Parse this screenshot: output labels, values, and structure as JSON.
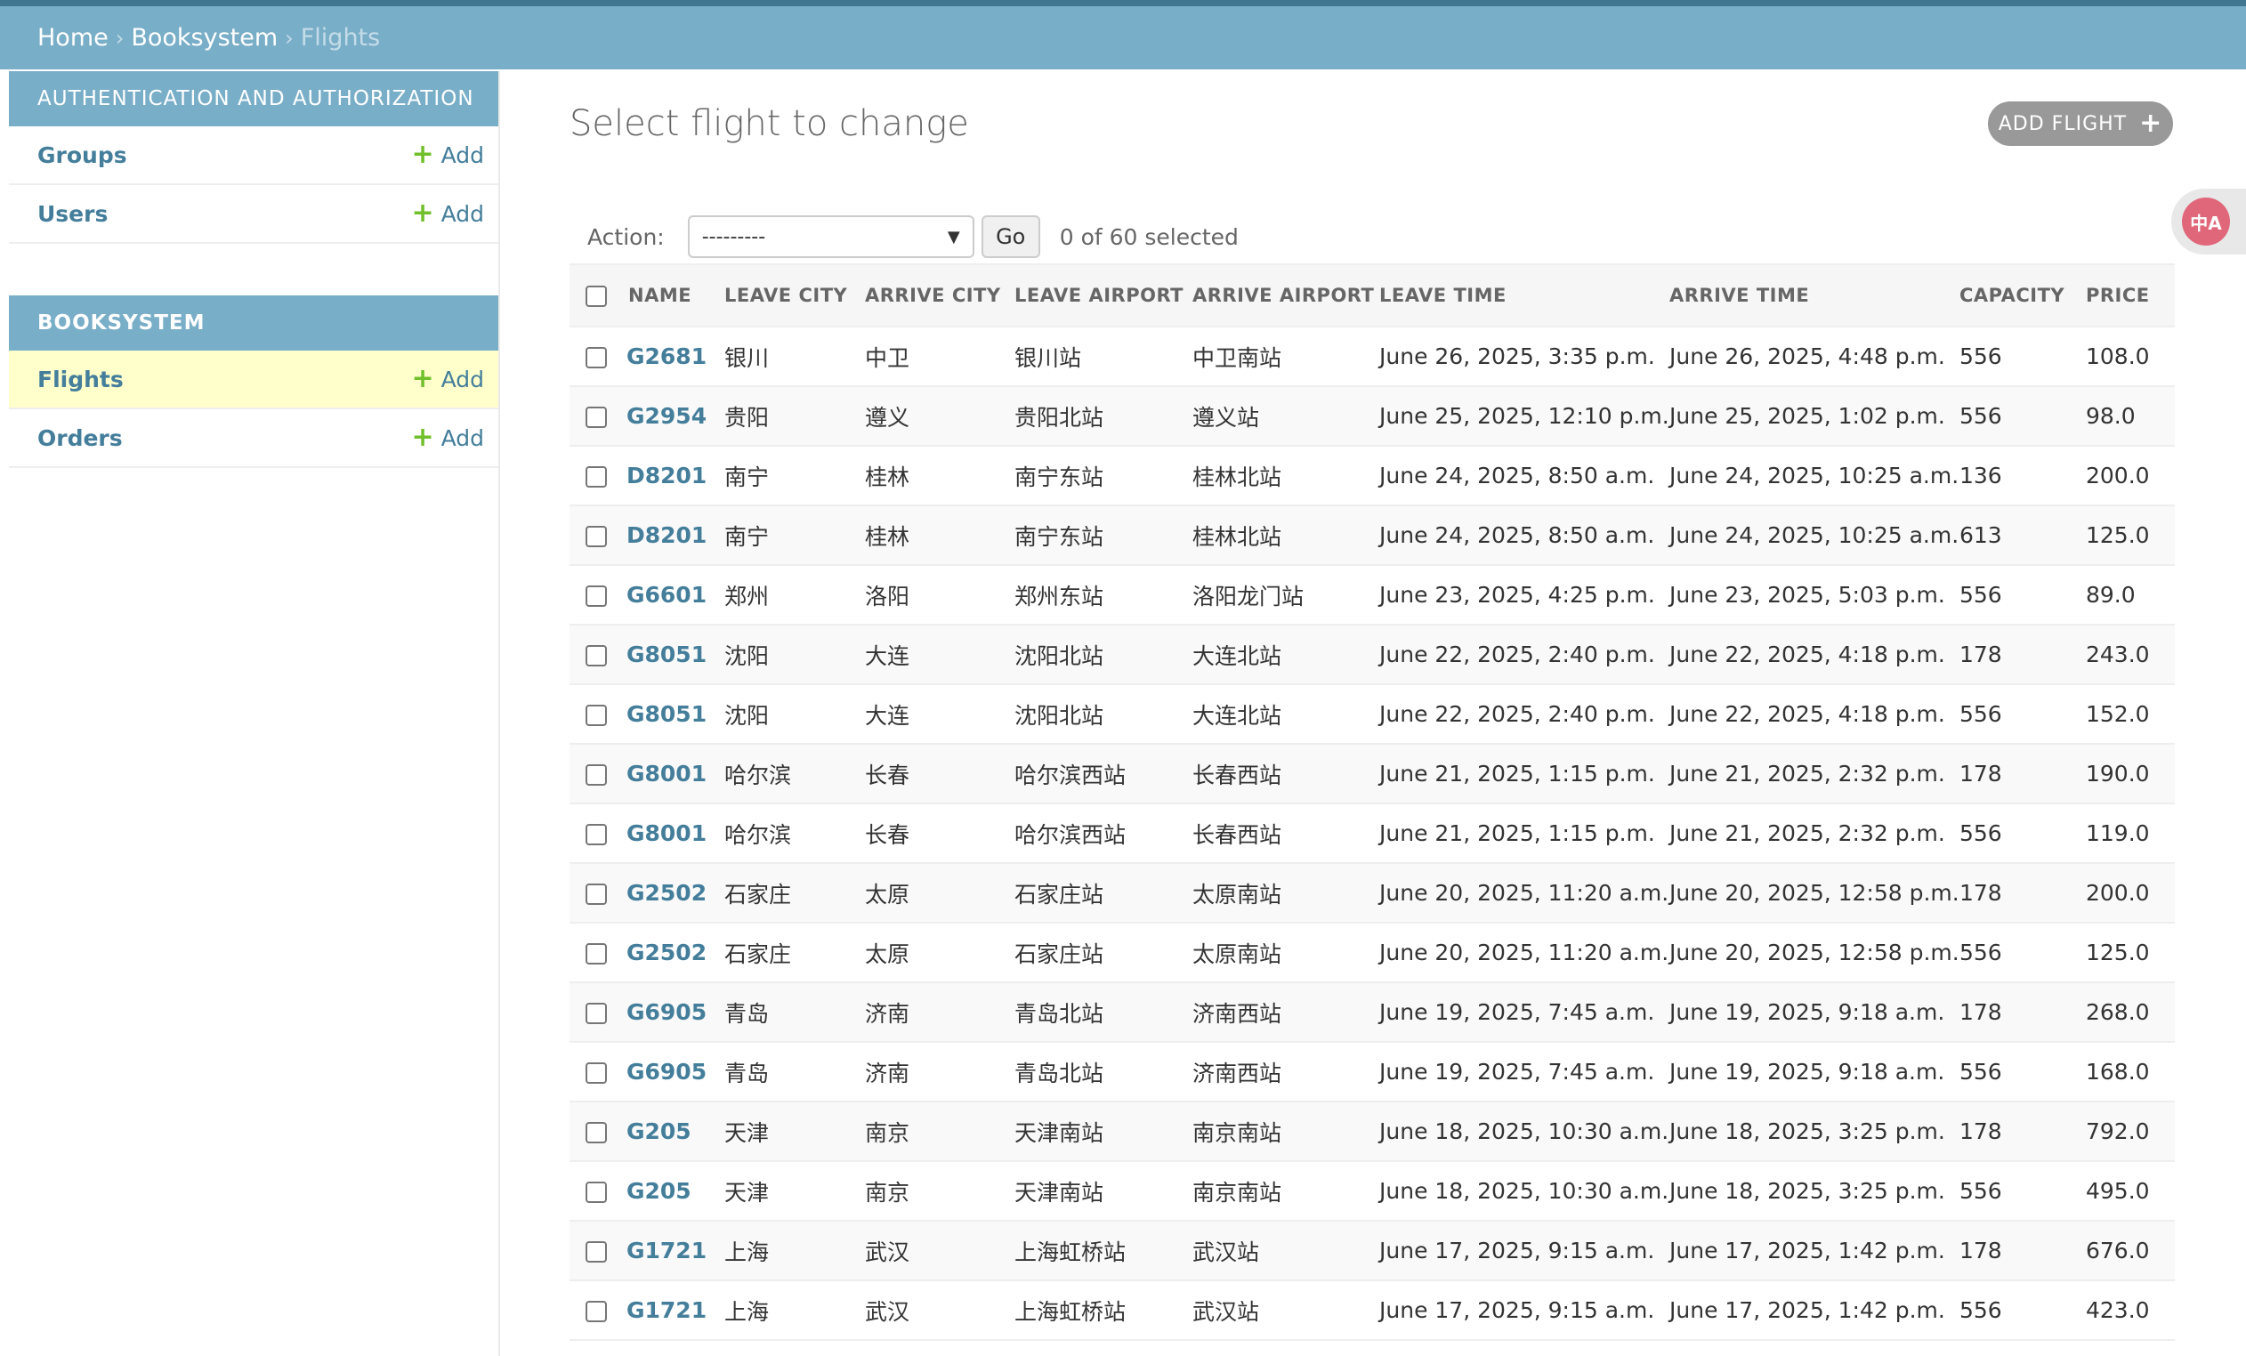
{
  "breadcrumb": {
    "home": "Home",
    "app": "Booksystem",
    "current": "Flights",
    "separator": "›"
  },
  "sidebar": {
    "modules": [
      {
        "caption": "AUTHENTICATION AND AUTHORIZATION",
        "models": [
          {
            "label": "Groups",
            "add_label": "Add"
          },
          {
            "label": "Users",
            "add_label": "Add"
          }
        ]
      },
      {
        "caption": "BOOKSYSTEM",
        "models": [
          {
            "label": "Flights",
            "add_label": "Add"
          },
          {
            "label": "Orders",
            "add_label": "Add"
          }
        ]
      }
    ]
  },
  "page": {
    "title": "Select flight to change",
    "add_button": "ADD FLIGHT"
  },
  "translate_widget": {
    "icon": "translate-icon",
    "glyph": "中A"
  },
  "actions": {
    "label": "Action:",
    "selected_option": "---------",
    "go_label": "Go",
    "counter": "0 of 60 selected"
  },
  "table": {
    "columns": [
      "NAME",
      "LEAVE CITY",
      "ARRIVE CITY",
      "LEAVE AIRPORT",
      "ARRIVE AIRPORT",
      "LEAVE TIME",
      "ARRIVE TIME",
      "CAPACITY",
      "PRICE"
    ],
    "rows": [
      [
        "G2681",
        "银川",
        "中卫",
        "银川站",
        "中卫南站",
        "June 26, 2025, 3:35 p.m.",
        "June 26, 2025, 4:48 p.m.",
        "556",
        "108.0"
      ],
      [
        "G2954",
        "贵阳",
        "遵义",
        "贵阳北站",
        "遵义站",
        "June 25, 2025, 12:10 p.m.",
        "June 25, 2025, 1:02 p.m.",
        "556",
        "98.0"
      ],
      [
        "D8201",
        "南宁",
        "桂林",
        "南宁东站",
        "桂林北站",
        "June 24, 2025, 8:50 a.m.",
        "June 24, 2025, 10:25 a.m.",
        "136",
        "200.0"
      ],
      [
        "D8201",
        "南宁",
        "桂林",
        "南宁东站",
        "桂林北站",
        "June 24, 2025, 8:50 a.m.",
        "June 24, 2025, 10:25 a.m.",
        "613",
        "125.0"
      ],
      [
        "G6601",
        "郑州",
        "洛阳",
        "郑州东站",
        "洛阳龙门站",
        "June 23, 2025, 4:25 p.m.",
        "June 23, 2025, 5:03 p.m.",
        "556",
        "89.0"
      ],
      [
        "G8051",
        "沈阳",
        "大连",
        "沈阳北站",
        "大连北站",
        "June 22, 2025, 2:40 p.m.",
        "June 22, 2025, 4:18 p.m.",
        "178",
        "243.0"
      ],
      [
        "G8051",
        "沈阳",
        "大连",
        "沈阳北站",
        "大连北站",
        "June 22, 2025, 2:40 p.m.",
        "June 22, 2025, 4:18 p.m.",
        "556",
        "152.0"
      ],
      [
        "G8001",
        "哈尔滨",
        "长春",
        "哈尔滨西站",
        "长春西站",
        "June 21, 2025, 1:15 p.m.",
        "June 21, 2025, 2:32 p.m.",
        "178",
        "190.0"
      ],
      [
        "G8001",
        "哈尔滨",
        "长春",
        "哈尔滨西站",
        "长春西站",
        "June 21, 2025, 1:15 p.m.",
        "June 21, 2025, 2:32 p.m.",
        "556",
        "119.0"
      ],
      [
        "G2502",
        "石家庄",
        "太原",
        "石家庄站",
        "太原南站",
        "June 20, 2025, 11:20 a.m.",
        "June 20, 2025, 12:58 p.m.",
        "178",
        "200.0"
      ],
      [
        "G2502",
        "石家庄",
        "太原",
        "石家庄站",
        "太原南站",
        "June 20, 2025, 11:20 a.m.",
        "June 20, 2025, 12:58 p.m.",
        "556",
        "125.0"
      ],
      [
        "G6905",
        "青岛",
        "济南",
        "青岛北站",
        "济南西站",
        "June 19, 2025, 7:45 a.m.",
        "June 19, 2025, 9:18 a.m.",
        "178",
        "268.0"
      ],
      [
        "G6905",
        "青岛",
        "济南",
        "青岛北站",
        "济南西站",
        "June 19, 2025, 7:45 a.m.",
        "June 19, 2025, 9:18 a.m.",
        "556",
        "168.0"
      ],
      [
        "G205",
        "天津",
        "南京",
        "天津南站",
        "南京南站",
        "June 18, 2025, 10:30 a.m.",
        "June 18, 2025, 3:25 p.m.",
        "178",
        "792.0"
      ],
      [
        "G205",
        "天津",
        "南京",
        "天津南站",
        "南京南站",
        "June 18, 2025, 10:30 a.m.",
        "June 18, 2025, 3:25 p.m.",
        "556",
        "495.0"
      ],
      [
        "G1721",
        "上海",
        "武汉",
        "上海虹桥站",
        "武汉站",
        "June 17, 2025, 9:15 a.m.",
        "June 17, 2025, 1:42 p.m.",
        "178",
        "676.0"
      ],
      [
        "G1721",
        "上海",
        "武汉",
        "上海虹桥站",
        "武汉站",
        "June 17, 2025, 9:15 a.m.",
        "June 17, 2025, 1:42 p.m.",
        "556",
        "423.0"
      ]
    ]
  },
  "colors": {
    "header_bg": "#79aec8",
    "topline": "#417690",
    "link": "#447e9b",
    "add_plus": "#70bf2b",
    "active_row": "#ffffcc"
  }
}
